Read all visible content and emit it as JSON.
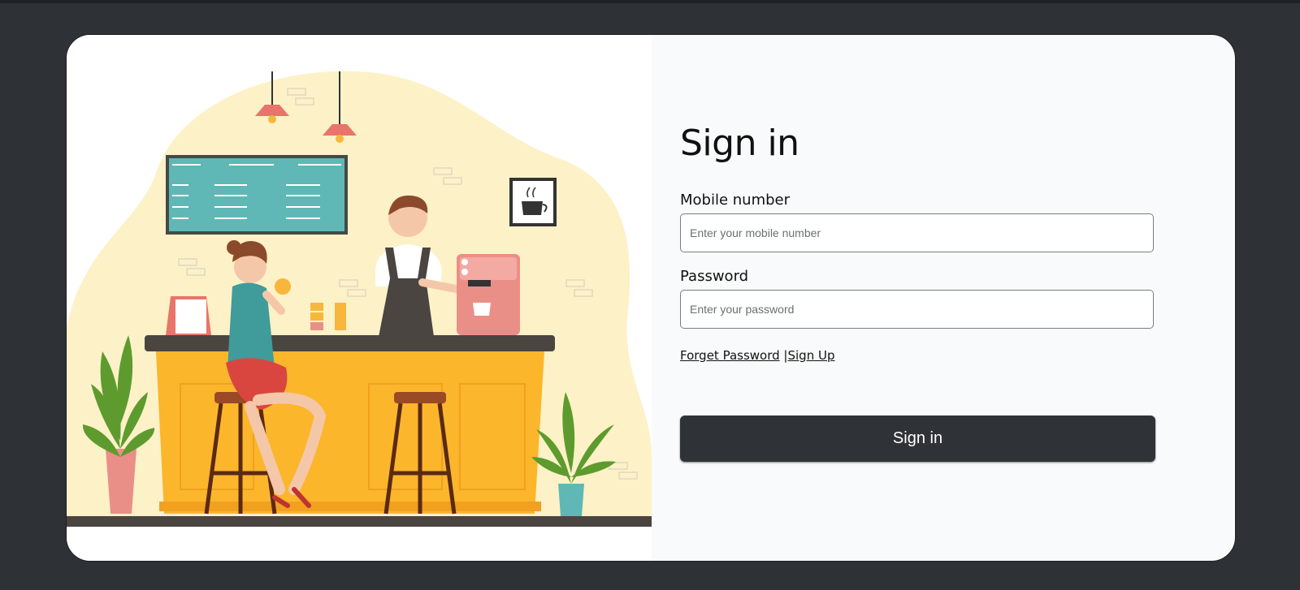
{
  "signin": {
    "title": "Sign in",
    "mobile_label": "Mobile number",
    "mobile_placeholder": "Enter your mobile number",
    "password_label": "Password",
    "password_placeholder": "Enter your password",
    "forget_password_link": "Forget Password",
    "separator": "|",
    "signup_link": "Sign Up",
    "submit_label": "Sign in"
  },
  "colors": {
    "background": "#2e3236",
    "card": "#f9fafb",
    "button": "#2f3338",
    "illustration_blob": "#fdf1c7",
    "counter": "#fbb62c"
  },
  "illustration": {
    "semantic": "cafe-barista-illustration"
  }
}
